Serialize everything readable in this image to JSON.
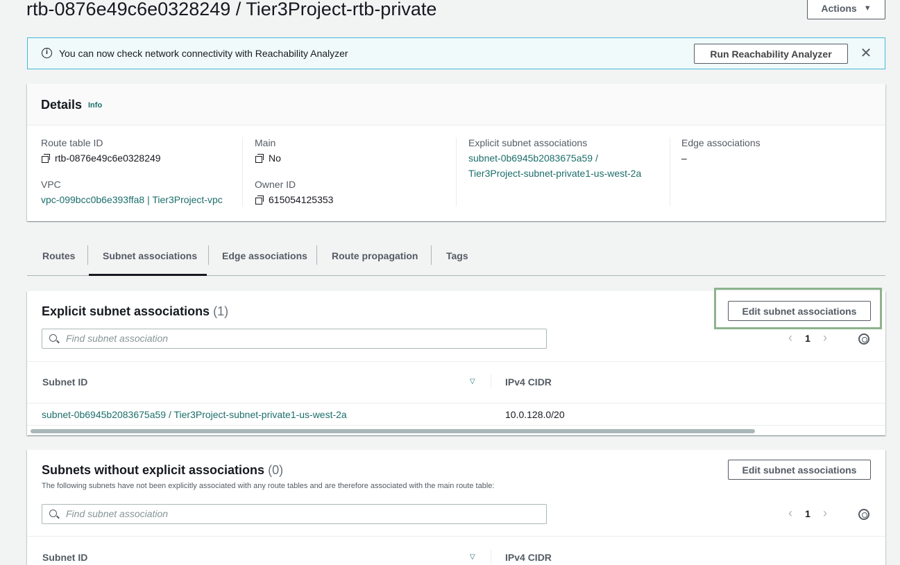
{
  "header": {
    "title": "rtb-0876e49c6e0328249 / Tier3Project-rtb-private",
    "actions_label": "Actions",
    "actions_caret": "▼"
  },
  "banner": {
    "info_glyph": "i",
    "text": "You can now check network connectivity with Reachability Analyzer",
    "button_label": "Run Reachability Analyzer",
    "close_glyph": "✕"
  },
  "details": {
    "title": "Details",
    "info": "Info",
    "route_table_id_label": "Route table ID",
    "route_table_id": "rtb-0876e49c6e0328249",
    "vpc_label": "VPC",
    "vpc": "vpc-099bcc0b6e393ffa8 | Tier3Project-vpc",
    "main_label": "Main",
    "main": "No",
    "owner_id_label": "Owner ID",
    "owner_id": "615054125353",
    "explicit_label": "Explicit subnet associations",
    "explicit_line1": "subnet-0b6945b2083675a59 /",
    "explicit_line2": "Tier3Project-subnet-private1-us-west-2a",
    "edge_label": "Edge associations",
    "edge_value": "–"
  },
  "tabs": [
    {
      "label": "Routes"
    },
    {
      "label": "Subnet associations"
    },
    {
      "label": "Edge associations"
    },
    {
      "label": "Route propagation"
    },
    {
      "label": "Tags"
    }
  ],
  "explicit_section": {
    "title": "Explicit subnet associations",
    "count": "(1)",
    "edit_label": "Edit subnet associations",
    "search_placeholder": "Find subnet association",
    "page": "1",
    "prev_glyph": "‹",
    "next_glyph": "›",
    "columns": [
      "Subnet ID",
      "IPv4 CIDR"
    ],
    "sort_glyph": "▽",
    "rows": [
      {
        "subnet": "subnet-0b6945b2083675a59 / Tier3Project-subnet-private1-us-west-2a",
        "cidr": "10.0.128.0/20"
      }
    ]
  },
  "implicit_section": {
    "title": "Subnets without explicit associations",
    "count": "(0)",
    "description": "The following subnets have not been explicitly associated with any route tables and are therefore associated with the main route table:",
    "edit_label": "Edit subnet associations",
    "search_placeholder": "Find subnet association",
    "page": "1",
    "prev_glyph": "‹",
    "next_glyph": "›",
    "columns": [
      "Subnet ID",
      "IPv4 CIDR"
    ],
    "sort_glyph": "▽"
  },
  "colors": {
    "link": "#1b6e6b",
    "banner_bg": "#f1fafb",
    "banner_border": "#44b9d6",
    "highlight": "#8cb38c"
  }
}
